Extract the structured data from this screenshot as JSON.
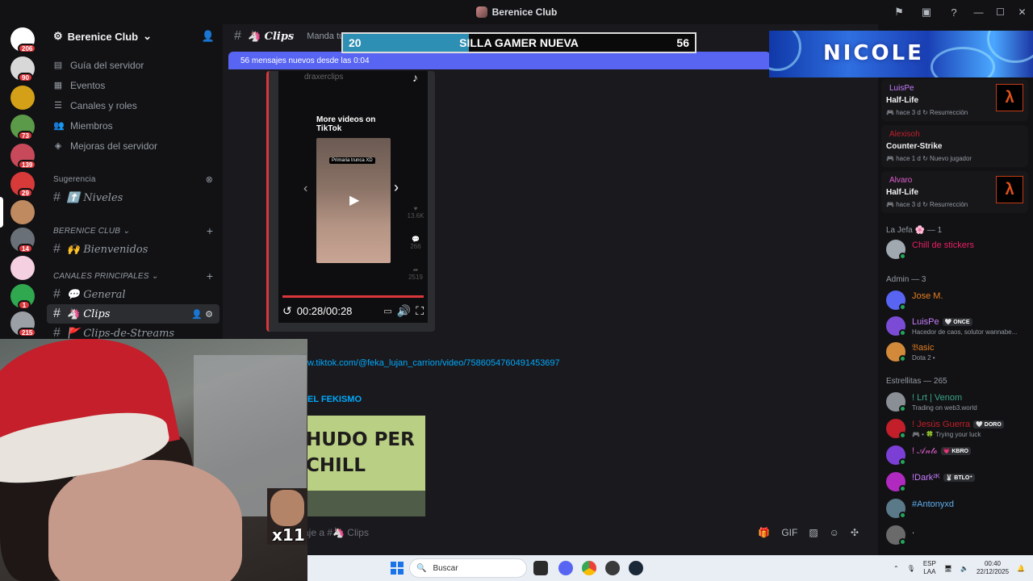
{
  "window": {
    "title": "Berenice Club"
  },
  "titlebar_icons": [
    "inbox-icon",
    "screen-icon",
    "help-icon"
  ],
  "rail": {
    "servers": [
      {
        "name": "discord-home",
        "badge": "206",
        "color": "#ffffff"
      },
      {
        "name": "server-1",
        "badge": "90",
        "color": "#d8d8d8"
      },
      {
        "name": "server-2",
        "badge": "",
        "color": "#d4a017"
      },
      {
        "name": "server-3",
        "badge": "73",
        "color": "#5a9a48"
      },
      {
        "name": "server-4",
        "badge": "139",
        "color": "#c84a5a"
      },
      {
        "name": "server-5",
        "badge": "29",
        "color": "#d83a3a"
      },
      {
        "name": "berenice-club",
        "badge": "",
        "color": "#c08a60"
      },
      {
        "name": "server-7",
        "badge": "14",
        "color": "#6a7078"
      },
      {
        "name": "server-8",
        "badge": "",
        "color": "#f5d0e0"
      },
      {
        "name": "server-9",
        "badge": "1",
        "color": "#2fa84f"
      },
      {
        "name": "server-10",
        "badge": "215",
        "color": "#9aa0a6"
      }
    ]
  },
  "sidebar": {
    "server_name": "Berenice Club",
    "nav": [
      {
        "icon": "book-icon",
        "glyph": "▤",
        "label": "Guía del servidor"
      },
      {
        "icon": "calendar-icon",
        "glyph": "▦",
        "label": "Eventos"
      },
      {
        "icon": "channels-roles-icon",
        "glyph": "☰",
        "label": "Canales y roles"
      },
      {
        "icon": "members-icon",
        "glyph": "👥",
        "label": "Miembros"
      },
      {
        "icon": "boost-icon",
        "glyph": "◈",
        "label": "Mejoras del servidor"
      }
    ],
    "suggestion_label": "Sugerencia",
    "suggestion_channel": "⬆️ Niveles",
    "category_1": "BERENICE CLUB",
    "channel_welcome": "🙌 Bienvenidos",
    "category_2": "CANALES PRINCIPALES",
    "channel_general": "💬 General",
    "channel_clips": "🦄 Clips",
    "channel_streams": "🚩 Clips-de-Streams"
  },
  "chat": {
    "channel": "🦄 Clips",
    "topic": "Manda tu",
    "new_messages": "56 mensajes nuevos desde las 0:04",
    "tiktok_user": "draxerclips",
    "tiktok_more": "More videos on TikTok",
    "tiktok_thumb_caption": "Primaria trunca XD",
    "tiktok_likes": "13.6K",
    "tiktok_comments": "266",
    "tiktok_shares": "2519",
    "video_time": "00:28/00:28",
    "link": "w.tiktok.com/@feka_lujan_carrion/video/7586054760491453697",
    "embed_author": "EL FEKISMO",
    "embed_thumb_text": "HUDO PER CHILL",
    "composer_placeholder": "aje a #🦄 Clips"
  },
  "overlay": {
    "goal_current": "20",
    "goal_label": "SILLA GAMER NUEVA",
    "goal_target": "56",
    "goal_progress": 0.357,
    "banner_text": "NICOLE",
    "emote_text": "x11"
  },
  "members": {
    "activities": [
      {
        "name": "LuisPe",
        "name_color": "#c77dff",
        "game": "Half-Life",
        "time": "hace 3 d",
        "detail": "Resurrección"
      },
      {
        "name": "Alexisoh",
        "name_color": "#c21f2a",
        "game": "Counter-Strike",
        "time": "hace 1 d",
        "detail": "Nuevo jugador"
      },
      {
        "name": "Alvaro",
        "name_color": "#e05fd0",
        "game": "Half-Life",
        "time": "hace 3 d",
        "detail": "Resurrección"
      }
    ],
    "group_jefa": "La Jefa 🌸 — 1",
    "jefa": {
      "name": "Chill de stickers",
      "color": "#e91e63"
    },
    "group_admin": "Admin — 3",
    "admins": [
      {
        "name": "Jose M.",
        "color": "#e67e22",
        "sub": "",
        "tag": ""
      },
      {
        "name": "LuisPe",
        "color": "#c77dff",
        "sub": "Hacedor de caos, solutor wannabe...",
        "tag": "🤍 ONCE"
      },
      {
        "name": "𝔅asic",
        "color": "#e67e22",
        "sub": "Dota 2 •",
        "tag": ""
      }
    ],
    "group_estrellitas": "Estrellitas — 265",
    "estrellitas": [
      {
        "name": "! Lrt | Venom",
        "color": "#3ba58b",
        "sub": "Trading on web3.world",
        "tag": ""
      },
      {
        "name": "! Jesús Guerra",
        "color": "#c21f2a",
        "sub": "🎮 • 🍀 Trying your luck",
        "tag": "🤍 DORO"
      },
      {
        "name": "! 𝒜𝓃𝓉ℴ",
        "color": "#e05fd0",
        "sub": "",
        "tag": "💗 KBRO"
      },
      {
        "name": "!Dark²ᴷ",
        "color": "#c77dff",
        "sub": "",
        "tag": "🐰 BTLO⁺"
      },
      {
        "name": "#Antonyxd",
        "color": "#5dadec",
        "sub": "",
        "tag": ""
      },
      {
        "name": ".",
        "color": "#dbdee1",
        "sub": "",
        "tag": ""
      }
    ]
  },
  "taskbar": {
    "search": "Buscar",
    "lang_1": "ESP",
    "lang_2": "LAA",
    "time": "00:40",
    "date": "22/12/2025"
  }
}
